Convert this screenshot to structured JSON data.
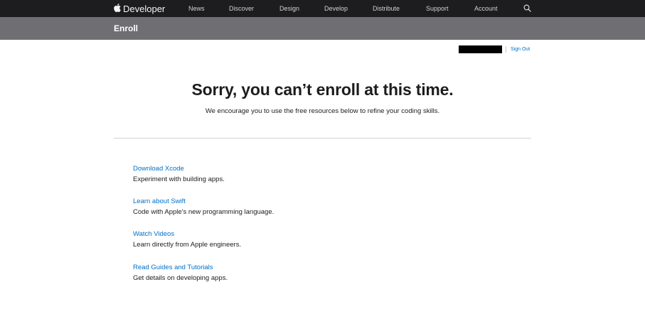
{
  "globalnav": {
    "brand_label": "Developer",
    "items": [
      {
        "label": "News"
      },
      {
        "label": "Discover"
      },
      {
        "label": "Design"
      },
      {
        "label": "Develop"
      },
      {
        "label": "Distribute"
      },
      {
        "label": "Support"
      },
      {
        "label": "Account"
      }
    ],
    "brand_icon": "apple-icon",
    "search_icon": "search-icon"
  },
  "localnav": {
    "title": "Enroll"
  },
  "account": {
    "signout_label": "Sign Out"
  },
  "main": {
    "headline": "Sorry, you can’t enroll at this time.",
    "subhead": "We encourage you to use the free resources below to refine your coding skills.",
    "resources": [
      {
        "link": "Download Xcode",
        "description": "Experiment with building apps."
      },
      {
        "link": "Learn about Swift",
        "description": "Code with Apple's new programming language."
      },
      {
        "link": "Watch Videos",
        "description": "Learn directly from Apple engineers."
      },
      {
        "link": "Read Guides and Tutorials",
        "description": "Get details on developing apps."
      }
    ]
  },
  "colors": {
    "globalnav_bg": "#1d1d1f",
    "localnav_bg": "#6e6e73",
    "link": "#0070c9",
    "text": "#1d1d1f"
  }
}
